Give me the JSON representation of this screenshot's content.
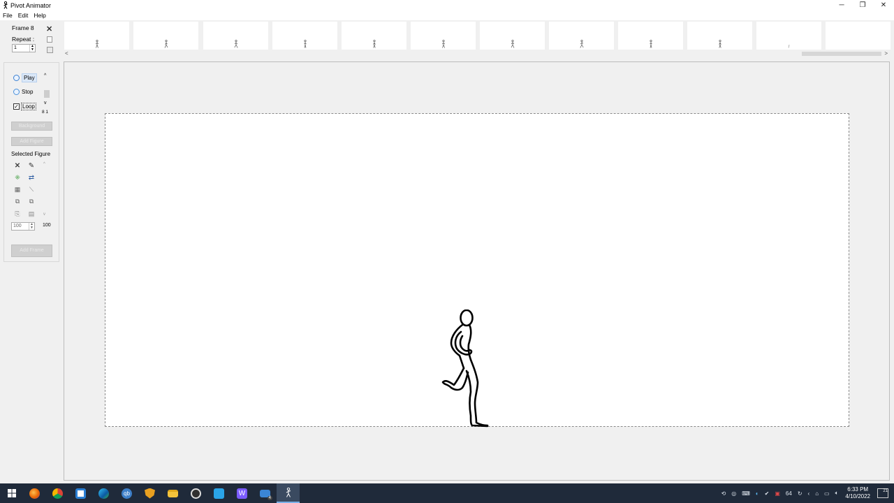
{
  "window": {
    "title": "Pivot Animator",
    "app_icon": "pivot-stickman-icon",
    "controls": {
      "minimize": "─",
      "maximize": "❐",
      "close": "✕"
    }
  },
  "menu": {
    "items": [
      "File",
      "Edit",
      "Help"
    ]
  },
  "frame_panel": {
    "frame_label": "Frame 8",
    "repeat_label": "Repeat :",
    "repeat_value": "1"
  },
  "timeline": {
    "thumbnail_count": 12,
    "scroll_left": "<",
    "scroll_right": ">"
  },
  "playback": {
    "play_label": "Play",
    "stop_label": "Stop",
    "loop_label": "Loop",
    "loop_checked": true,
    "speed_up": "^",
    "speed_down": "v",
    "speed_value": "8 1"
  },
  "buttons": {
    "background": "Background",
    "add_figure": "Add Figure",
    "add_frame": "Add Frame"
  },
  "selected_figure": {
    "label": "Selected Figure",
    "size_value": "100",
    "size_display": "100"
  },
  "taskbar": {
    "apps": [
      "start",
      "firefox",
      "chrome",
      "store",
      "edge",
      "qbittorrent",
      "shield",
      "file-explorer",
      "obs",
      "bookmarks",
      "maps",
      "mail",
      "pivot"
    ],
    "mail_badge": "4",
    "tray_items": [
      "64"
    ],
    "time": "6:33 PM",
    "date": "4/10/2022",
    "notification_count": "21"
  },
  "colors": {
    "taskbar_bg": "#1f2a3a",
    "window_bg": "#f0f0f0",
    "stage_bg": "#ffffff"
  }
}
